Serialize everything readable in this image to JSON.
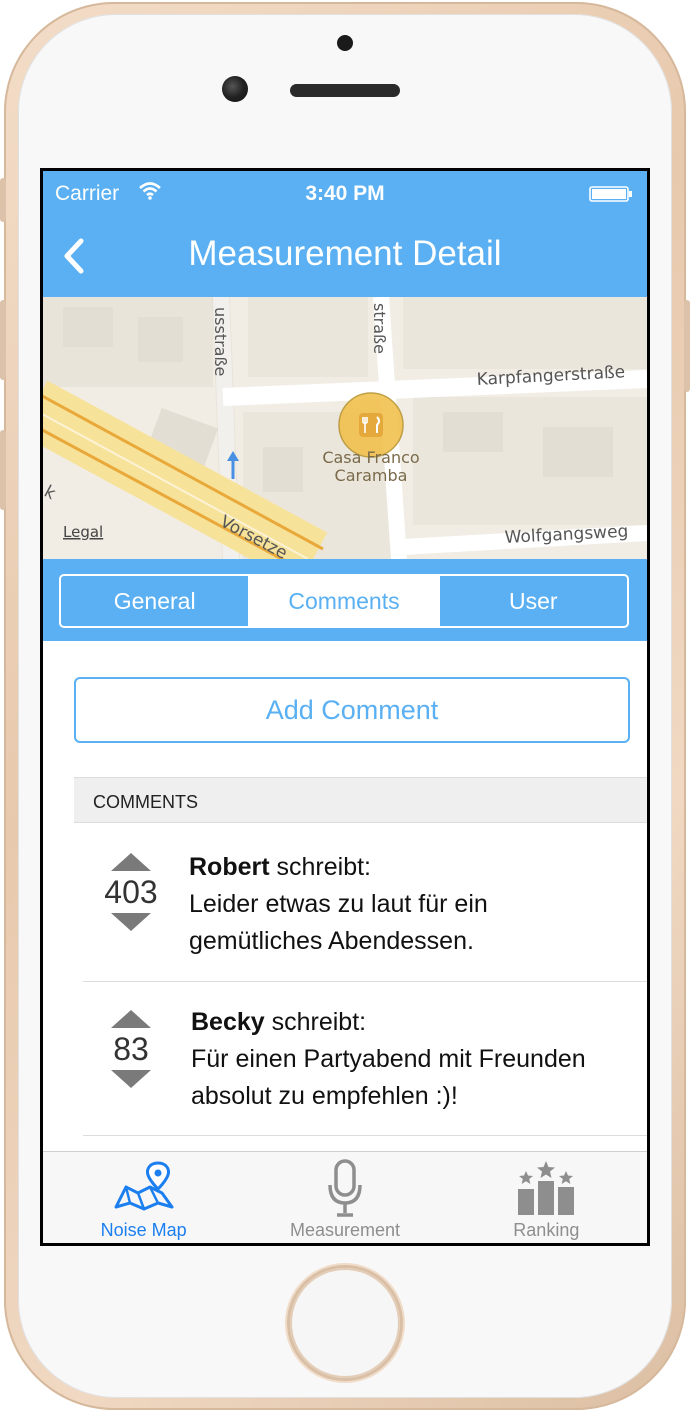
{
  "status_bar": {
    "carrier": "Carrier",
    "time": "3:40 PM"
  },
  "nav": {
    "title": "Measurement Detail",
    "back_icon": "chevron-left-icon"
  },
  "map": {
    "streets": [
      "usstraße",
      "straße",
      "Karpfangerstraße",
      "Wolfgangsweg",
      "Vorsetze",
      "k"
    ],
    "poi_name_line1": "Casa Franco",
    "poi_name_line2": "Caramba",
    "poi_icon": "restaurant-icon",
    "legal": "Legal"
  },
  "segments": {
    "items": [
      "General",
      "Comments",
      "User"
    ],
    "selected": "Comments"
  },
  "add_comment_label": "Add Comment",
  "comments_header": "COMMENTS",
  "comments": [
    {
      "author": "Robert",
      "writes": " schreibt:",
      "votes": "403",
      "line1": "Leider etwas zu laut für ein",
      "line2": "gemütliches Abendessen."
    },
    {
      "author": "Becky",
      "writes": " schreibt:",
      "votes": "83",
      "line1": "Für einen Partyabend mit Freunden",
      "line2": "absolut zu empfehlen :)!"
    }
  ],
  "tabs": [
    {
      "label": "Noise Map",
      "icon": "map-pin-icon",
      "active": true
    },
    {
      "label": "Measurement",
      "icon": "microphone-icon",
      "active": false
    },
    {
      "label": "Ranking",
      "icon": "podium-icon",
      "active": false
    }
  ],
  "colors": {
    "accent": "#5ab0f2",
    "tab_active": "#1c7ff0",
    "tab_inactive": "#8e8e8e",
    "poi": "#f2c14e"
  }
}
